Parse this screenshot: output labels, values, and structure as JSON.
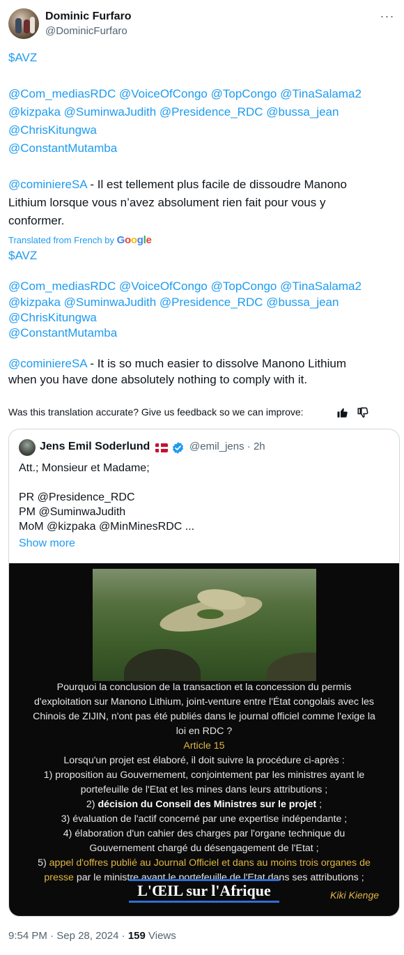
{
  "author": {
    "name": "Dominic Furfaro",
    "handle": "@DominicFurfaro"
  },
  "original": {
    "lines": [
      [
        "$AVZ"
      ],
      [
        ""
      ],
      [
        "@Com_mediasRDC @VoiceOfCongo @TopCongo @TinaSalama2"
      ],
      [
        "@kizpaka @SuminwaJudith @Presidence_RDC @bussa_jean"
      ],
      [
        "@ChrisKitungwa"
      ],
      [
        "@ConstantMutamba"
      ],
      [
        ""
      ],
      [
        "@cominiereSA",
        " - Il est tellement plus facile de dissoudre Manono"
      ],
      [
        "Lithium lorsque vous n’avez absolument rien fait pour vous y"
      ],
      [
        "conformer."
      ]
    ]
  },
  "translation": {
    "label": "Translated from French by",
    "provider": "Google",
    "lines": [
      [
        "$AVZ"
      ],
      [
        ""
      ],
      [
        "@Com_mediasRDC @VoiceOfCongo @TopCongo @TinaSalama2"
      ],
      [
        "@kizpaka @SuminwaJudith @Presidence_RDC @bussa_jean"
      ],
      [
        "@ChrisKitungwa"
      ],
      [
        "@ConstantMutamba"
      ],
      [
        ""
      ],
      [
        "@cominiereSA",
        " - It is so much easier to dissolve Manono Lithium"
      ],
      [
        "when you have done absolutely nothing to comply with it."
      ]
    ],
    "feedback": "Was this translation accurate? Give us feedback so we can improve:"
  },
  "quote": {
    "name": "Jens Emil Soderlund",
    "handle": "@emil_jens",
    "time": "2h",
    "lines": [
      "Att.; Monsieur et Madame;",
      "",
      "PR @Presidence_RDC",
      "PM @SuminwaJudith",
      "MoM @kizpaka @MinMinesRDC ..."
    ],
    "show_more": "Show more",
    "image": {
      "lines": [
        [
          [
            "n",
            "Pourquoi la conclusion de la transaction et la concession du permis"
          ]
        ],
        [
          [
            "n",
            "d'exploitation sur Manono Lithium, joint-venture entre l'État congolais avec les"
          ]
        ],
        [
          [
            "n",
            "Chinois de ZIJIN, n'ont pas été publiés dans le journal officiel comme l'exige la"
          ]
        ],
        [
          [
            "n",
            "loi en RDC ?"
          ]
        ],
        [
          [
            "g",
            "Article 15"
          ]
        ],
        [
          [
            "n",
            "Lorsqu'un projet est élaboré, il doit suivre la procédure ci-après :"
          ]
        ],
        [
          [
            "n",
            "1) proposition au Gouvernement, conjointement par les ministres ayant le"
          ]
        ],
        [
          [
            "n",
            "portefeuille de l'Etat et les mines dans leurs attributions ;"
          ]
        ],
        [
          [
            "n",
            "2) "
          ],
          [
            "b",
            "décision du Conseil des Ministres sur le projet"
          ],
          [
            "n",
            " ;"
          ]
        ],
        [
          [
            "n",
            "3) évaluation de l'actif concerné par une expertise indépendante ;"
          ]
        ],
        [
          [
            "n",
            "4) élaboration d'un cahier des charges par l'organe technique du"
          ]
        ],
        [
          [
            "n",
            "Gouvernement chargé du désengagement de l'Etat ;"
          ]
        ],
        [
          [
            "n",
            "5) "
          ],
          [
            "g",
            "appel d'offres publié au Journal Officiel et dans au moins trois organes de"
          ]
        ],
        [
          [
            "g",
            "presse"
          ],
          [
            "n",
            " par le ministre ayant le portefeuille de l'Etat dans ses attributions ;"
          ]
        ]
      ],
      "brand": "L'ŒIL sur l'Afrique",
      "credit": "Kiki Kienge",
      "colors": {
        "gold": "#e0b542",
        "brand_blue": "#2f6fd6"
      }
    }
  },
  "meta": {
    "time": "9:54 PM",
    "date": "Sep 28, 2024",
    "views": "159",
    "views_label": "Views"
  },
  "colors": {
    "link": "#1d9bf0",
    "secondary": "#536471",
    "border": "#cfd9de"
  }
}
